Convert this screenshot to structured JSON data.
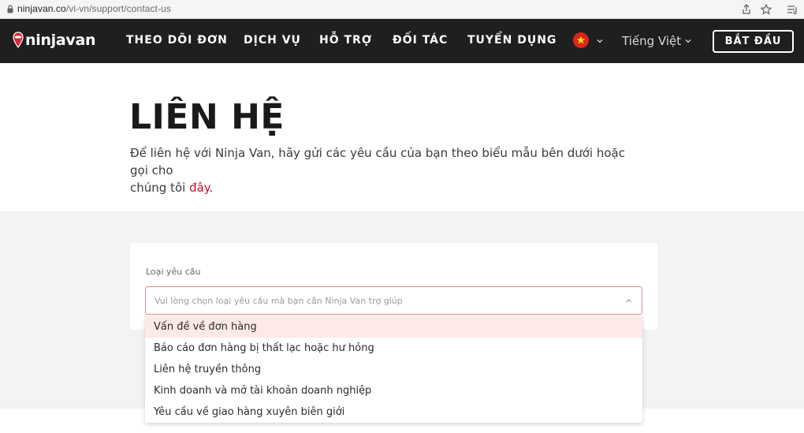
{
  "browser": {
    "url_host": "ninjavan.co",
    "url_path": "/vi-vn/support/contact-us",
    "icons": [
      "lock-icon",
      "share-icon",
      "star-icon",
      "reading-list-icon"
    ]
  },
  "nav": {
    "logo_text": "ninjavan",
    "links": [
      "THEO DÕI ĐƠN",
      "DỊCH VỤ",
      "HỖ TRỢ",
      "ĐỐI TÁC",
      "TUYỂN DỤNG"
    ],
    "language": "Tiếng Việt",
    "start_button": "BẮT ĐẦU",
    "flag": "vietnam-flag-icon"
  },
  "hero": {
    "title": "LIÊN HỆ",
    "description_line1": "Để liên hệ với Ninja Van, hãy gửi các yêu cầu của bạn theo biểu mẫu bên dưới hoặc gọi cho",
    "description_line2_prefix": "chúng tôi ",
    "description_link": "đây",
    "description_suffix": "."
  },
  "form": {
    "request_type_label": "Loại yêu cầu",
    "request_type_placeholder": "Vui lòng chọn loại yêu cầu mà bạn cần Ninja Van trợ giúp",
    "options": [
      "Vấn đề về đơn hàng",
      "Báo cáo đơn hàng bị thất lạc hoặc hư hỏng",
      "Liên hệ truyền thông",
      "Kinh doanh và mở tài khoản doanh nghiệp",
      "Yêu cầu về giao hàng xuyên biên giới"
    ],
    "highlighted_option_index": 0
  },
  "colors": {
    "nav_bg": "#1f1f1f",
    "accent_red": "#c8102e",
    "highlight_bg": "#fde9e7",
    "section_grey": "#f2f3f5"
  }
}
